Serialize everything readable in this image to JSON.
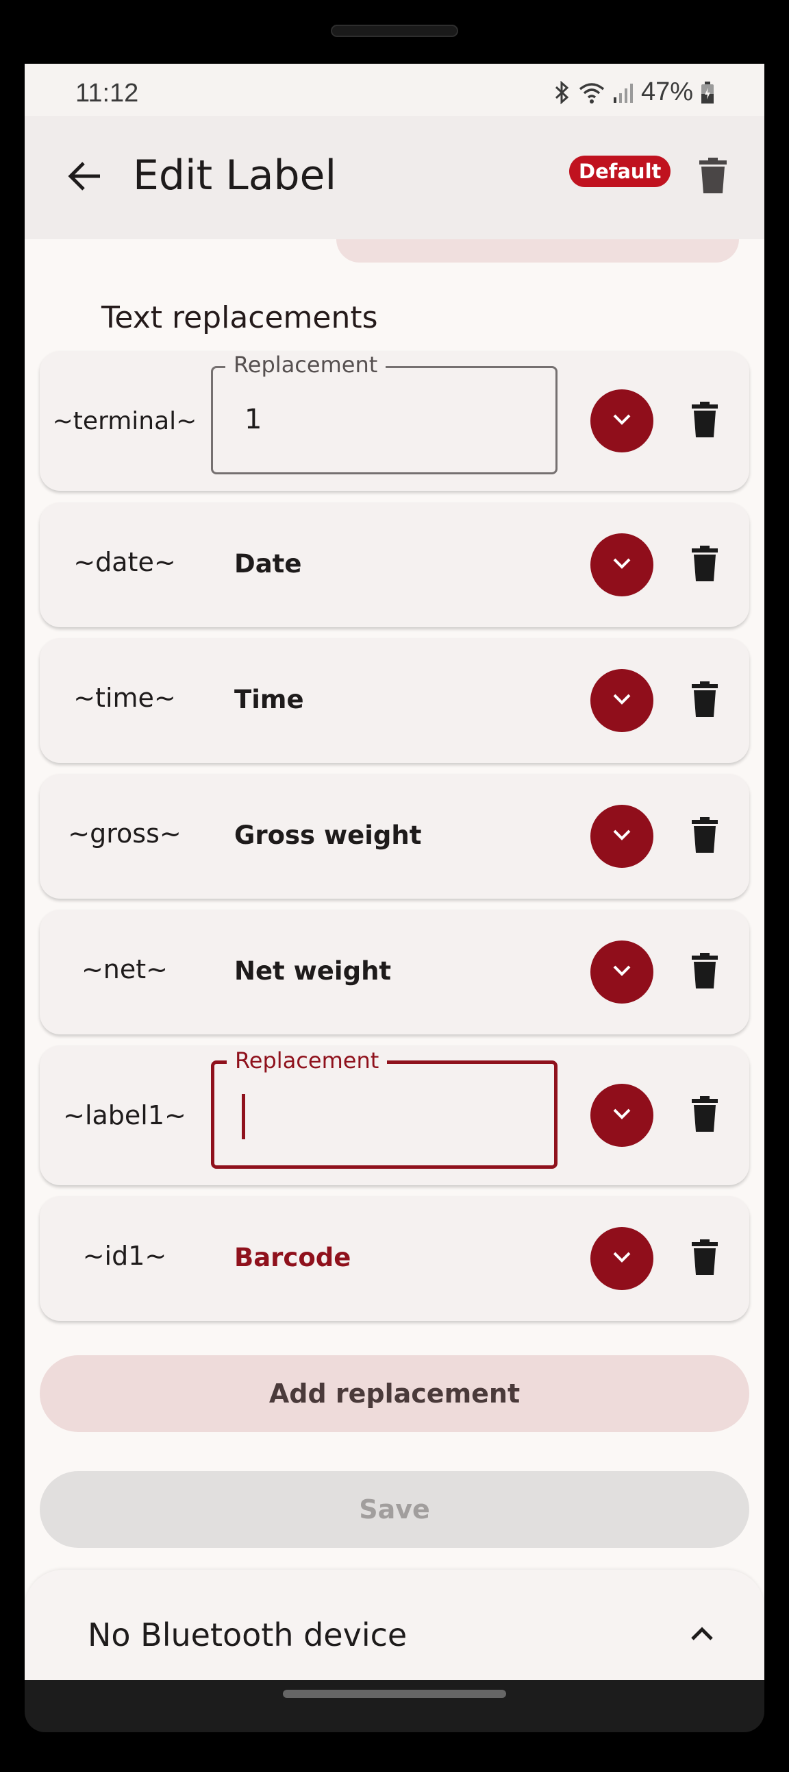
{
  "status_bar": {
    "time": "11:12",
    "battery": "47%"
  },
  "app_bar": {
    "title": "Edit Label",
    "badge": "Default"
  },
  "section": {
    "title": "Text replacements"
  },
  "replacements": [
    {
      "key": "~terminal~",
      "field_label": "Replacement",
      "value": "1"
    },
    {
      "key": "~date~",
      "value": "Date"
    },
    {
      "key": "~time~",
      "value": "Time"
    },
    {
      "key": "~gross~",
      "value": "Gross weight"
    },
    {
      "key": "~net~",
      "value": "Net weight"
    },
    {
      "key": "~label1~",
      "field_label": "Replacement",
      "value": ""
    },
    {
      "key": "~id1~",
      "value": "Barcode"
    }
  ],
  "buttons": {
    "add": "Add replacement",
    "save": "Save"
  },
  "bluetooth": {
    "status": "No Bluetooth device"
  },
  "colors": {
    "accent": "#900e1b",
    "badge": "#c0121f",
    "background": "#fbf8f6"
  },
  "icons": [
    "back-arrow-icon",
    "trash-icon",
    "chevron-down-icon",
    "chevron-up-icon",
    "bluetooth-icon",
    "wifi-icon",
    "signal-icon",
    "battery-icon"
  ]
}
